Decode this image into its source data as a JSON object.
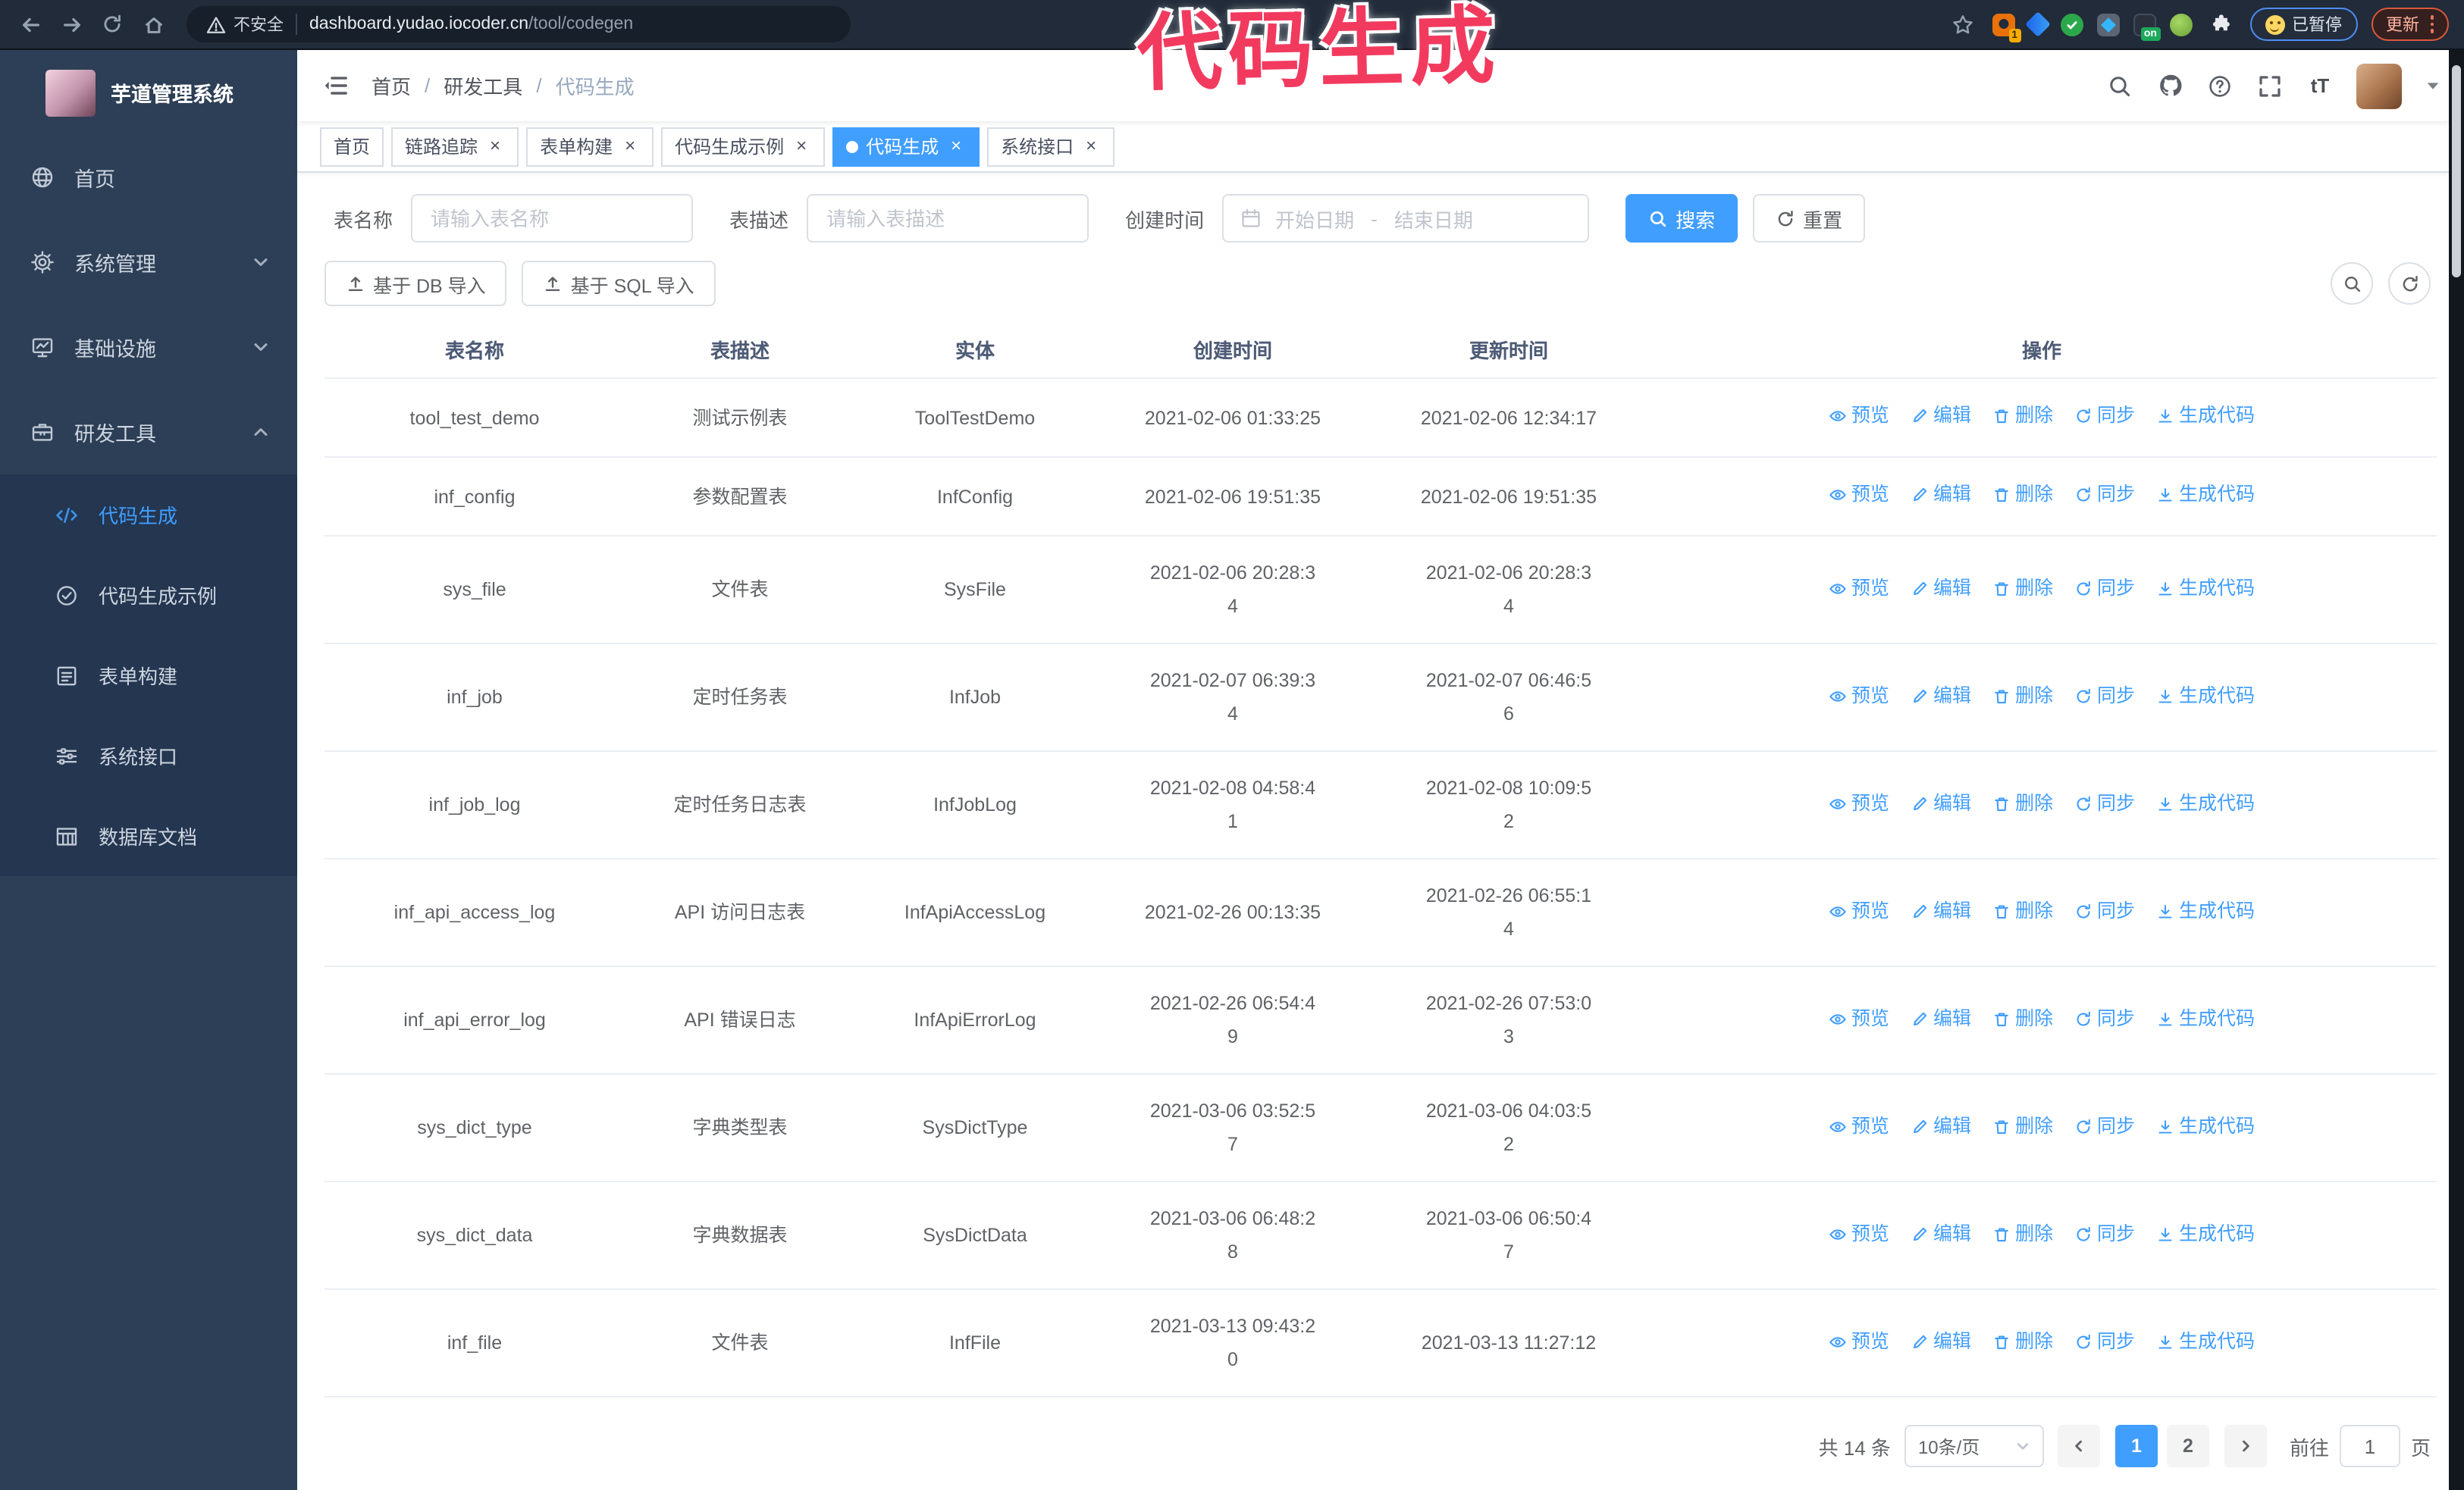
{
  "colors": {
    "accent": "#409eff",
    "annotation": "#f23a5f",
    "chrome_bg": "#212b39",
    "sidebar_bg": "#2d3f56",
    "submenu_bg": "#243650",
    "active_tab_bg": "#409eff",
    "update_border": "#d9583b",
    "paused_border": "#4e8df6"
  },
  "browser": {
    "security_label": "不安全",
    "url_host": "dashboard.yudao.iocoder.cn",
    "url_path": "/tool/codegen",
    "paused_badge": "已暂停",
    "update_label": "更新",
    "extension_badge": "1",
    "extension_on_badge": "on"
  },
  "annotation": {
    "text": "代码生成"
  },
  "sidebar": {
    "title": "芋道管理系统",
    "items": [
      {
        "key": "home",
        "icon": "dashboard-icon",
        "label": "首页"
      },
      {
        "key": "system-management",
        "icon": "gear-icon",
        "label": "系统管理",
        "chevron": "down"
      },
      {
        "key": "infrastructure",
        "icon": "monitor-icon",
        "label": "基础设施",
        "chevron": "down"
      },
      {
        "key": "dev-tools",
        "icon": "toolbox-icon",
        "label": "研发工具",
        "chevron": "up",
        "expanded": true
      }
    ],
    "submenu": [
      {
        "key": "codegen",
        "icon": "code-icon",
        "label": "代码生成",
        "active": true
      },
      {
        "key": "codegen-example",
        "icon": "badge-check-icon",
        "label": "代码生成示例"
      },
      {
        "key": "form-builder",
        "icon": "form-icon",
        "label": "表单构建"
      },
      {
        "key": "system-api",
        "icon": "sliders-icon",
        "label": "系统接口"
      },
      {
        "key": "database-doc",
        "icon": "db-table-icon",
        "label": "数据库文档"
      }
    ]
  },
  "navbar": {
    "breadcrumb": [
      "首页",
      "研发工具",
      "代码生成"
    ],
    "separator": "/"
  },
  "tabs": [
    {
      "key": "home",
      "label": "首页",
      "closable": false,
      "active": false
    },
    {
      "key": "tracing",
      "label": "链路追踪",
      "closable": true,
      "active": false
    },
    {
      "key": "form-builder",
      "label": "表单构建",
      "closable": true,
      "active": false
    },
    {
      "key": "codegen-example",
      "label": "代码生成示例",
      "closable": true,
      "active": false
    },
    {
      "key": "codegen",
      "label": "代码生成",
      "closable": true,
      "active": true
    },
    {
      "key": "system-api",
      "label": "系统接口",
      "closable": true,
      "active": false
    }
  ],
  "filters": {
    "name_label": "表名称",
    "name_placeholder": "请输入表名称",
    "desc_label": "表描述",
    "desc_placeholder": "请输入表描述",
    "date_label": "创建时间",
    "date_start_placeholder": "开始日期",
    "date_separator": "-",
    "date_end_placeholder": "结束日期",
    "search_label": "搜索",
    "reset_label": "重置"
  },
  "toolbar": {
    "db_import_label": "基于 DB 导入",
    "sql_import_label": "基于 SQL 导入"
  },
  "table": {
    "columns": [
      "表名称",
      "表描述",
      "实体",
      "创建时间",
      "更新时间",
      "操作"
    ],
    "action_labels": [
      "预览",
      "编辑",
      "删除",
      "同步",
      "生成代码"
    ],
    "rows": [
      {
        "name": "tool_test_demo",
        "desc": "测试示例表",
        "entity": "ToolTestDemo",
        "created": "2021-02-06 01:33:25",
        "created_wrapped": false,
        "updated": "2021-02-06 12:34:17",
        "updated_wrapped": false
      },
      {
        "name": "inf_config",
        "desc": "参数配置表",
        "entity": "InfConfig",
        "created": "2021-02-06 19:51:35",
        "created_wrapped": false,
        "updated": "2021-02-06 19:51:35",
        "updated_wrapped": false
      },
      {
        "name": "sys_file",
        "desc": "文件表",
        "entity": "SysFile",
        "created": "2021-02-06 20:28:34",
        "created_wrapped": true,
        "updated": "2021-02-06 20:28:34",
        "updated_wrapped": true
      },
      {
        "name": "inf_job",
        "desc": "定时任务表",
        "entity": "InfJob",
        "created": "2021-02-07 06:39:34",
        "created_wrapped": true,
        "updated": "2021-02-07 06:46:56",
        "updated_wrapped": true
      },
      {
        "name": "inf_job_log",
        "desc": "定时任务日志表",
        "entity": "InfJobLog",
        "created": "2021-02-08 04:58:41",
        "created_wrapped": true,
        "updated": "2021-02-08 10:09:52",
        "updated_wrapped": true
      },
      {
        "name": "inf_api_access_log",
        "desc": "API 访问日志表",
        "entity": "InfApiAccessLog",
        "created": "2021-02-26 00:13:35",
        "created_wrapped": false,
        "updated": "2021-02-26 06:55:14",
        "updated_wrapped": true
      },
      {
        "name": "inf_api_error_log",
        "desc": "API 错误日志",
        "entity": "InfApiErrorLog",
        "created": "2021-02-26 06:54:49",
        "created_wrapped": true,
        "updated": "2021-02-26 07:53:03",
        "updated_wrapped": true
      },
      {
        "name": "sys_dict_type",
        "desc": "字典类型表",
        "entity": "SysDictType",
        "created": "2021-03-06 03:52:57",
        "created_wrapped": true,
        "updated": "2021-03-06 04:03:52",
        "updated_wrapped": true
      },
      {
        "name": "sys_dict_data",
        "desc": "字典数据表",
        "entity": "SysDictData",
        "created": "2021-03-06 06:48:28",
        "created_wrapped": true,
        "updated": "2021-03-06 06:50:47",
        "updated_wrapped": true
      },
      {
        "name": "inf_file",
        "desc": "文件表",
        "entity": "InfFile",
        "created": "2021-03-13 09:43:20",
        "created_wrapped": true,
        "updated": "2021-03-13 11:27:12",
        "updated_wrapped": false
      }
    ]
  },
  "pagination": {
    "total_label": "共 14 条",
    "page_size_label": "10条/页",
    "pages": [
      "1",
      "2"
    ],
    "active_page": "1",
    "goto_label": "前往",
    "goto_value": "1",
    "page_unit_label": "页"
  }
}
